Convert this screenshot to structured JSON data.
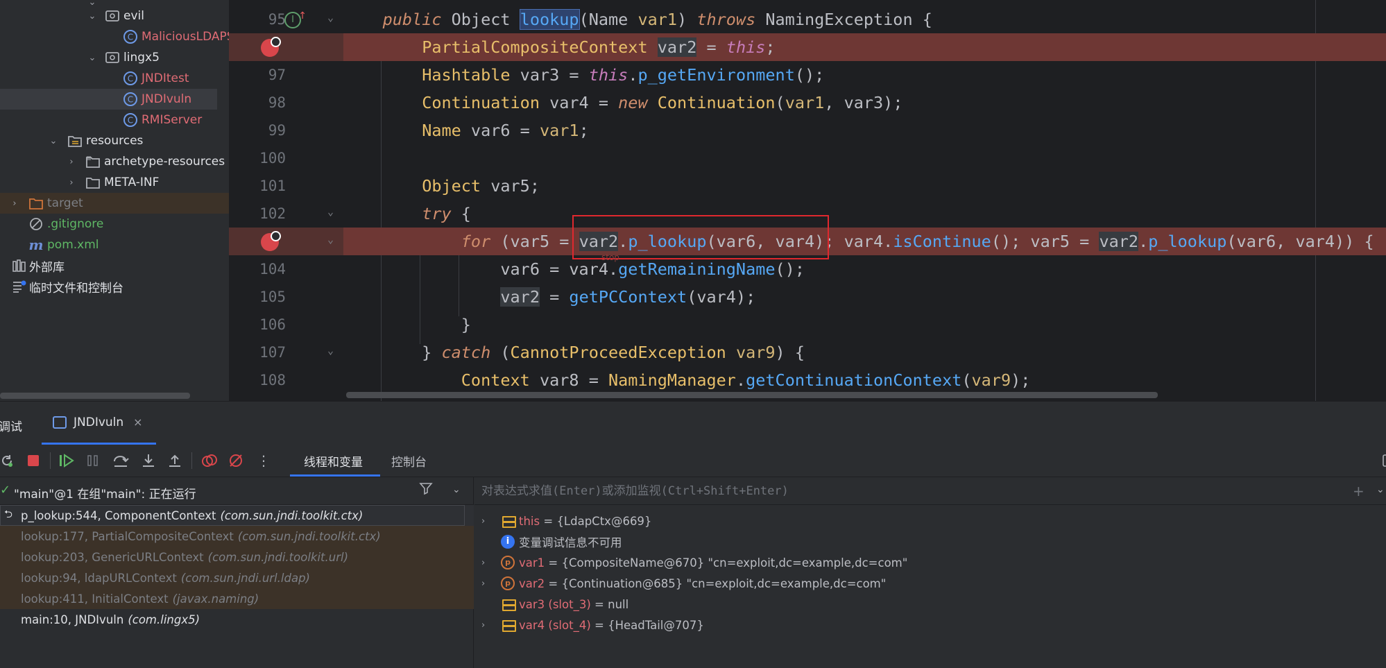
{
  "project_tree": [
    {
      "label": "evil",
      "kind": "package",
      "expanded": true
    },
    {
      "label": "MaliciousLDAPS",
      "kind": "class",
      "color": "#e06c75"
    },
    {
      "label": "lingx5",
      "kind": "package",
      "expanded": true
    },
    {
      "label": "JNDItest",
      "kind": "class",
      "color": "#e06c75"
    },
    {
      "label": "JNDIvuln",
      "kind": "class",
      "color": "#e06c75",
      "selected": true
    },
    {
      "label": "RMIServer",
      "kind": "class",
      "color": "#e06c75"
    },
    {
      "label": "resources",
      "kind": "resources-folder",
      "expanded": true
    },
    {
      "label": "archetype-resources",
      "kind": "folder",
      "expanded": false
    },
    {
      "label": "META-INF",
      "kind": "folder",
      "expanded": false
    },
    {
      "label": "target",
      "kind": "excluded-folder",
      "expanded": false
    },
    {
      "label": ".gitignore",
      "kind": "ignore-file"
    },
    {
      "label": "pom.xml",
      "kind": "maven-file"
    },
    {
      "label": "外部库",
      "kind": "library"
    },
    {
      "label": "临时文件和控制台",
      "kind": "scratches"
    }
  ],
  "editor": {
    "line_numbers": [
      "95",
      "",
      "97",
      "98",
      "99",
      "100",
      "101",
      "102",
      "",
      "104",
      "105",
      "106",
      "107",
      "108"
    ],
    "breakpoint_lines": [
      1,
      8
    ],
    "stop_hint": "stop"
  },
  "debug": {
    "title": "调试",
    "session_tab": "JNDIvuln",
    "close_icon": "×",
    "tabs": [
      "线程和变量",
      "控制台"
    ],
    "thread": "\"main\"@1 在组\"main\": 正在运行",
    "frames": [
      {
        "method": "p_lookup:544, ComponentContext",
        "pkg": "(com.sun.jndi.toolkit.ctx)",
        "state": "current"
      },
      {
        "method": "lookup:177, PartialCompositeContext",
        "pkg": "(com.sun.jndi.toolkit.ctx)",
        "state": "lib"
      },
      {
        "method": "lookup:203, GenericURLContext",
        "pkg": "(com.sun.jndi.toolkit.url)",
        "state": "lib"
      },
      {
        "method": "lookup:94, ldapURLContext",
        "pkg": "(com.sun.jndi.url.ldap)",
        "state": "lib"
      },
      {
        "method": "lookup:411, InitialContext",
        "pkg": "(javax.naming)",
        "state": "lib"
      },
      {
        "method": "main:10, JNDIvuln",
        "pkg": "(com.lingx5)",
        "state": "user"
      }
    ],
    "eval_placeholder": "对表达式求值(Enter)或添加监视(Ctrl+Shift+Enter)",
    "variables": [
      {
        "name": "this",
        "value": "{LdapCtx@669}",
        "icon": "field",
        "expandable": true
      },
      {
        "name": "",
        "value": "变量调试信息不可用",
        "icon": "info",
        "expandable": false
      },
      {
        "name": "var1",
        "value": "{CompositeName@670} \"cn=exploit,dc=example,dc=com\"",
        "icon": "param",
        "expandable": true
      },
      {
        "name": "var2",
        "value": "{Continuation@685} \"cn=exploit,dc=example,dc=com\"",
        "icon": "param",
        "expandable": true
      },
      {
        "name": "var3 (slot_3)",
        "value": "null",
        "icon": "field",
        "expandable": false
      },
      {
        "name": "var4 (slot_4)",
        "value": "{HeadTail@707}",
        "icon": "field",
        "expandable": true
      }
    ]
  }
}
